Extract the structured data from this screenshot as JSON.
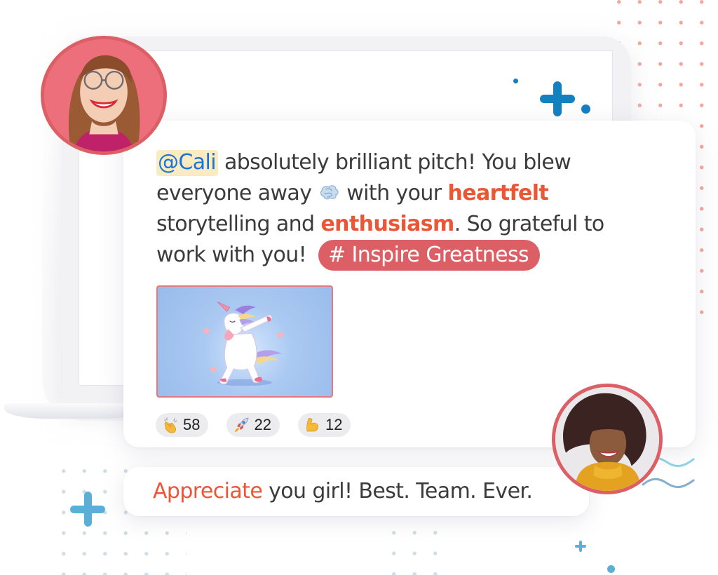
{
  "post": {
    "mention": "@Cali",
    "text_1": " absolutely brilliant pitch! You blew everyone away ",
    "emoji_wind": "dashing-away-emoji",
    "text_2": " with your ",
    "highlight_1": "heartfelt",
    "text_3": " storytelling and ",
    "highlight_2": "enthusiasm",
    "text_4": ". So grateful to work with you! ",
    "hashtag": "# Inspire Greatness",
    "attachment": "dabbing-unicorn-gif"
  },
  "reactions": [
    {
      "icon": "clapping-hands-icon",
      "count": "58"
    },
    {
      "icon": "rocket-icon",
      "count": "22"
    },
    {
      "icon": "flexed-biceps-icon",
      "count": "12"
    }
  ],
  "reply": {
    "highlight": "Appreciate",
    "text": " you girl! Best. Team. Ever."
  },
  "colors": {
    "accent": "#eb5636",
    "hashtag_bg": "#dc5f66",
    "mention_bg": "#fbebc1",
    "mention_text": "#1a73d9",
    "decor_blue": "#1380c0",
    "decor_light_blue": "#5bafd6",
    "dot_coral": "#f3a79c"
  }
}
